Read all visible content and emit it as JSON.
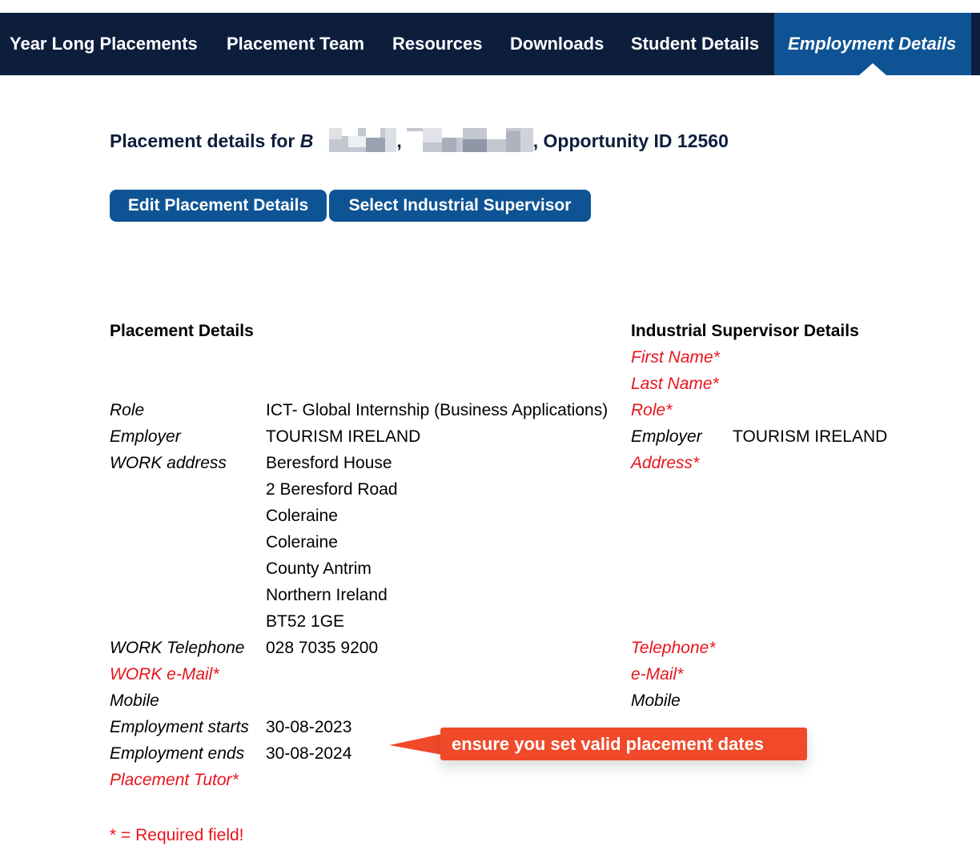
{
  "nav": {
    "items": [
      {
        "label": "Year Long Placements"
      },
      {
        "label": "Placement Team"
      },
      {
        "label": "Resources"
      },
      {
        "label": "Downloads"
      },
      {
        "label": "Student Details"
      },
      {
        "label": "Employment Details"
      }
    ],
    "active": "Employment Details"
  },
  "heading": {
    "prefix": "Placement details for ",
    "name_initial": "B",
    "separator": ",",
    "opportunity": ", Opportunity ID 12560"
  },
  "buttons": {
    "edit": "Edit Placement Details",
    "select_supervisor": "Select Industrial Supervisor"
  },
  "placement": {
    "title": "Placement Details",
    "role_label": "Role",
    "role_value": "ICT- Global Internship (Business Applications)",
    "employer_label": "Employer",
    "employer_value": "TOURISM IRELAND",
    "address_label": "WORK address",
    "address_lines": [
      "Beresford House",
      "2 Beresford Road",
      "Coleraine",
      "Coleraine",
      "County Antrim",
      "Northern Ireland",
      "BT52 1GE"
    ],
    "telephone_label": "WORK Telephone",
    "telephone_value": "028 7035 9200",
    "email_label": "WORK e-Mail*",
    "mobile_label": "Mobile",
    "starts_label": "Employment starts",
    "starts_value": "30-08-2023",
    "ends_label": "Employment ends",
    "ends_value": "30-08-2024",
    "tutor_label": "Placement Tutor*"
  },
  "supervisor": {
    "title": "Industrial Supervisor Details",
    "first_name_label": "First Name*",
    "last_name_label": "Last Name*",
    "role_label": "Role*",
    "employer_label": "Employer",
    "employer_value": "TOURISM IRELAND",
    "address_label": "Address*",
    "telephone_label": "Telephone*",
    "email_label": "e-Mail*",
    "mobile_label": "Mobile"
  },
  "footnote": "* = Required field!",
  "callout": "ensure you set valid placement dates",
  "colors": {
    "nav_bg": "#0d1e3d",
    "nav_active": "#0e5495",
    "button": "#0e5495",
    "required": "#e8141c",
    "callout": "#f04a2a"
  }
}
